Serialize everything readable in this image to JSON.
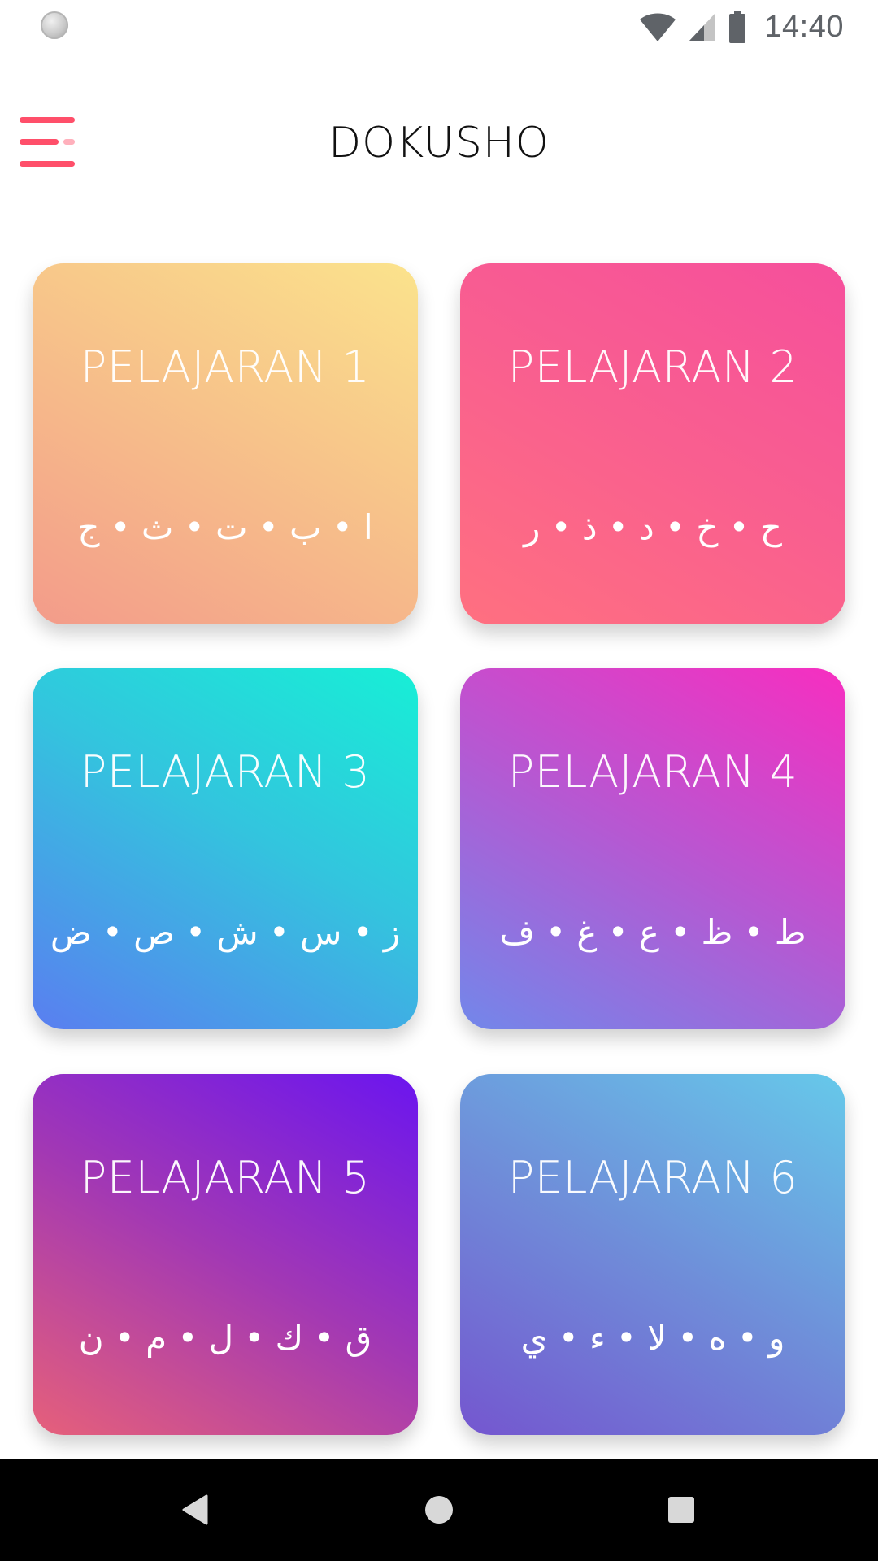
{
  "status_bar": {
    "time": "14:40"
  },
  "app_bar": {
    "title": "DOKUSHO",
    "menu_icon": "hamburger-menu-icon",
    "accent_color": "#ff4f6a"
  },
  "lessons": [
    {
      "title": "PELAJARAN 1",
      "letters": "ا • ب • ت • ث • ج"
    },
    {
      "title": "PELAJARAN 2",
      "letters": "ح • خ • د • ذ • ر"
    },
    {
      "title": "PELAJARAN 3",
      "letters": "ز • س • ش • ص • ض"
    },
    {
      "title": "PELAJARAN 4",
      "letters": "ط • ظ • ع • غ • ف"
    },
    {
      "title": "PELAJARAN 5",
      "letters": "ق • ك • ل • م • ن"
    },
    {
      "title": "PELAJARAN 6",
      "letters": "و • ه • لا • ء • ي"
    }
  ],
  "nav_bar": {
    "back_icon": "back-triangle-icon",
    "home_icon": "home-circle-icon",
    "recents_icon": "recents-square-icon"
  }
}
